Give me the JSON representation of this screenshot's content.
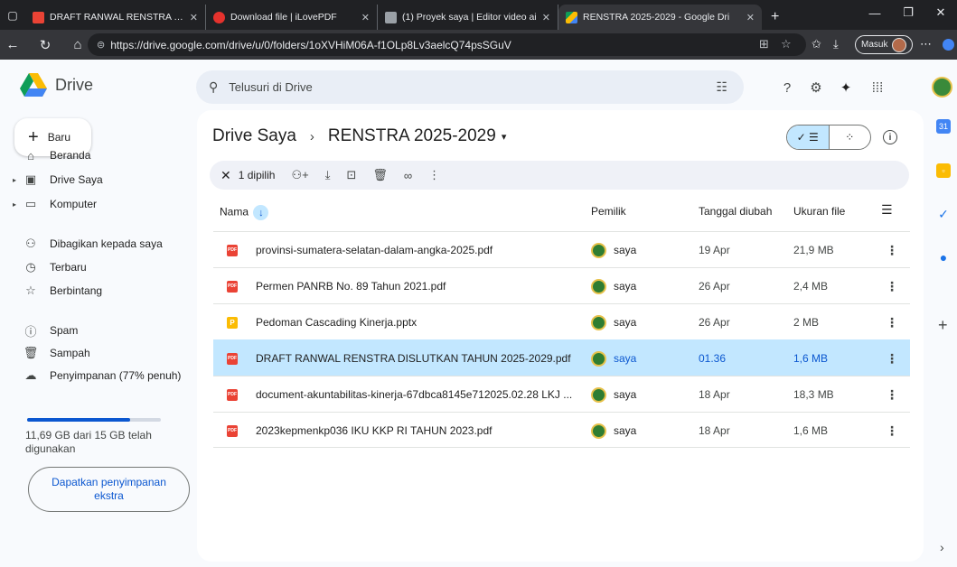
{
  "browser": {
    "tabs": [
      {
        "label": "DRAFT RANWAL RENSTRA DISLUT",
        "favicon_color": "#ea4335",
        "active": false
      },
      {
        "label": "Download file | iLovePDF",
        "favicon_color": "#e5322d",
        "active": false
      },
      {
        "label": "(1) Proyek saya | Editor video ai",
        "favicon_color": "#9aa0a6",
        "active": false
      },
      {
        "label": "RENSTRA 2025-2029 - Google Dri",
        "favicon_color": "#fbbc04",
        "active": true
      }
    ],
    "url": "https://drive.google.com/drive/u/0/folders/1oXVHiM06A-f1OLp8Lv3aelcQ74psSGuV",
    "signin_label": "Masuk"
  },
  "header": {
    "app_name": "Drive",
    "search_placeholder": "Telusuri di Drive"
  },
  "sidebar": {
    "new_label": "Baru",
    "items": [
      {
        "label": "Beranda",
        "icon": "home-icon",
        "caret": false
      },
      {
        "label": "Drive Saya",
        "icon": "my-drive-icon",
        "caret": true
      },
      {
        "label": "Komputer",
        "icon": "computer-icon",
        "caret": true
      },
      {
        "label": "Dibagikan kepada saya",
        "icon": "shared-icon",
        "caret": false
      },
      {
        "label": "Terbaru",
        "icon": "clock-icon",
        "caret": false
      },
      {
        "label": "Berbintang",
        "icon": "star-icon",
        "caret": false
      },
      {
        "label": "Spam",
        "icon": "spam-icon",
        "caret": false
      },
      {
        "label": "Sampah",
        "icon": "trash-icon",
        "caret": false
      },
      {
        "label": "Penyimpanan (77% penuh)",
        "icon": "cloud-icon",
        "caret": false
      }
    ],
    "storage_percent": 77,
    "storage_text": "11,69 GB dari 15 GB telah digunakan",
    "get_storage_label": "Dapatkan penyimpanan ekstra"
  },
  "main": {
    "breadcrumb_root": "Drive Saya",
    "breadcrumb_separator": "›",
    "folder_name": "RENSTRA 2025-2029",
    "selection_label": "1 dipilih",
    "columns": {
      "name": "Nama",
      "owner": "Pemilik",
      "modified": "Tanggal diubah",
      "size": "Ukuran file"
    },
    "files": [
      {
        "name": "provinsi-sumatera-selatan-dalam-angka-2025.pdf",
        "type": "pdf",
        "owner": "saya",
        "modified": "19 Apr",
        "size": "21,9 MB",
        "selected": false
      },
      {
        "name": "Permen PANRB No. 89 Tahun 2021.pdf",
        "type": "pdf",
        "owner": "saya",
        "modified": "26 Apr",
        "size": "2,4 MB",
        "selected": false
      },
      {
        "name": "Pedoman Cascading Kinerja.pptx",
        "type": "pptx",
        "owner": "saya",
        "modified": "26 Apr",
        "size": "2 MB",
        "selected": false
      },
      {
        "name": "DRAFT RANWAL RENSTRA DISLUTKAN TAHUN 2025-2029.pdf",
        "type": "pdf",
        "owner": "saya",
        "modified": "01.36",
        "size": "1,6 MB",
        "selected": true
      },
      {
        "name": "document-akuntabilitas-kinerja-67dbca8145e712025.02.28 LKJ ...",
        "type": "pdf",
        "owner": "saya",
        "modified": "18 Apr",
        "size": "18,3 MB",
        "selected": false
      },
      {
        "name": "2023kepmenkp036 IKU KKP RI TAHUN 2023.pdf",
        "type": "pdf",
        "owner": "saya",
        "modified": "18 Apr",
        "size": "1,6 MB",
        "selected": false
      }
    ]
  },
  "side_panel": [
    {
      "icon": "calendar-icon",
      "color": "#4285f4"
    },
    {
      "icon": "keep-icon",
      "color": "#fbbc04"
    },
    {
      "icon": "tasks-icon",
      "color": "#1a73e8"
    },
    {
      "icon": "contacts-icon",
      "color": "#1a73e8"
    }
  ],
  "colors": {
    "accent": "#0b57d0",
    "selected_row": "#c2e7ff",
    "pdf_red": "#ea4335",
    "slides_yellow": "#fbbc04"
  }
}
